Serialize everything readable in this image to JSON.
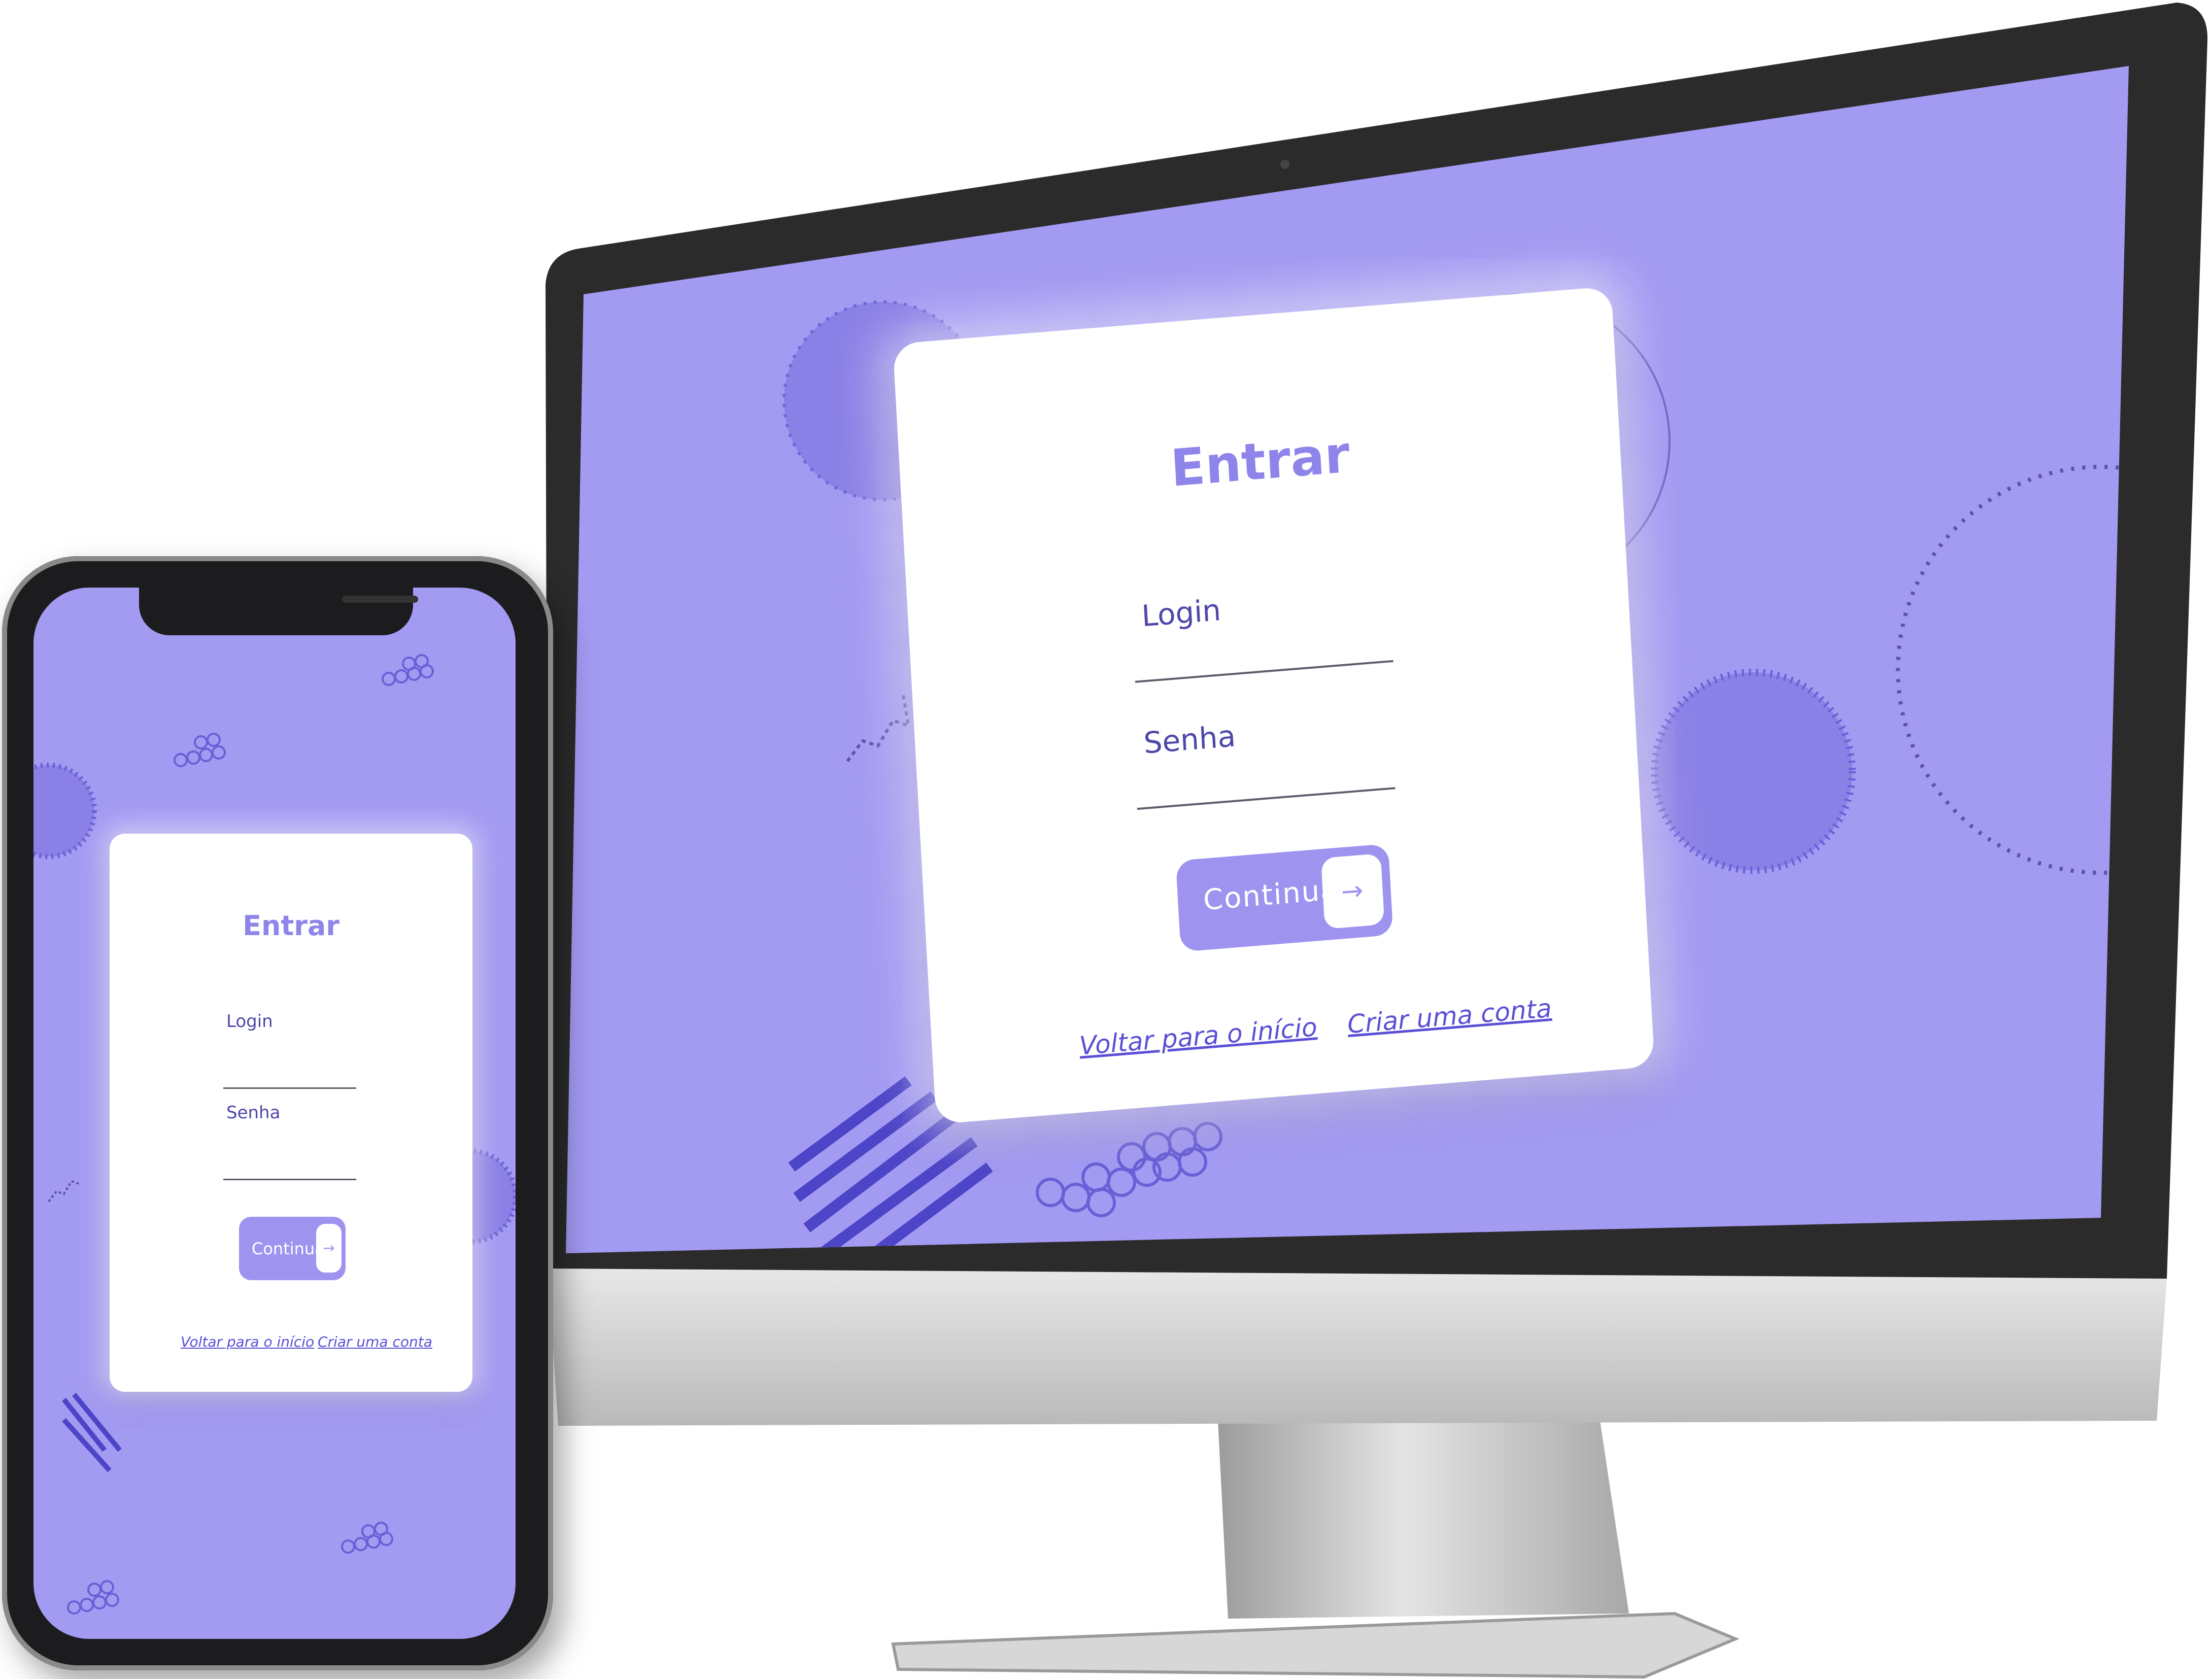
{
  "colors": {
    "background": "#a39af2",
    "accent": "#9e94f0",
    "title": "#8f84ea",
    "link": "#5a4fd6",
    "bezel": "#2b2b2b"
  },
  "desktop": {
    "login_card": {
      "title": "Entrar",
      "login_label": "Login",
      "password_label": "Senha",
      "continue_button": "Continuar",
      "continue_icon": "→",
      "back_link": "Voltar para o início",
      "create_account_link": "Criar uma conta"
    }
  },
  "mobile": {
    "login_card": {
      "title": "Entrar",
      "login_label": "Login",
      "password_label": "Senha",
      "continue_button": "Continuar",
      "continue_icon": "→",
      "back_link": "Voltar para o início",
      "create_account_link": "Criar uma conta"
    }
  }
}
